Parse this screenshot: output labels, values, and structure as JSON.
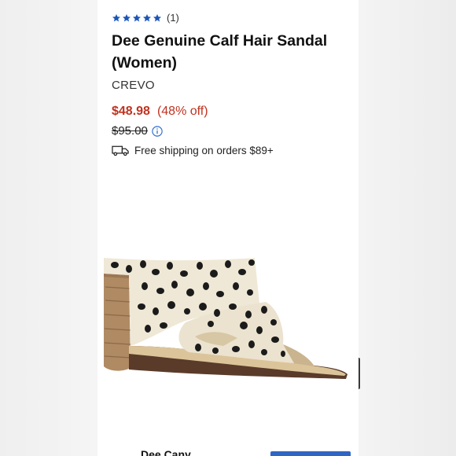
{
  "product": {
    "rating_stars": 5,
    "rating_count": "(1)",
    "title": "Dee Genuine Calf Hair Sandal (Women)",
    "brand": "CREVO",
    "sale_price": "$48.98",
    "discount": "(48% off)",
    "original_price": "$95.00",
    "shipping_text": "Free shipping on orders $89+"
  },
  "icons": {
    "star": "star-icon",
    "info": "info-icon",
    "truck": "truck-icon"
  },
  "bottom_bar": {
    "brand_label": "Dee Cany"
  },
  "colors": {
    "star": "#1a56b8",
    "price": "#c0321f",
    "info": "#2b6cd4",
    "button": "#2f66c4"
  }
}
